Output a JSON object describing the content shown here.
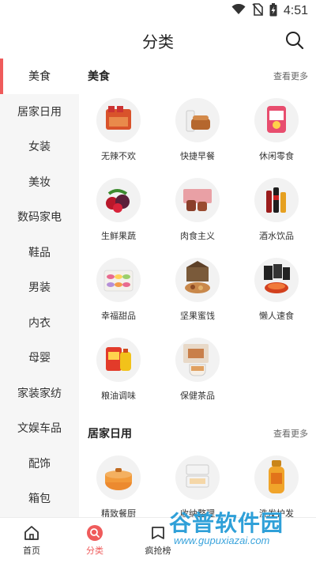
{
  "status": {
    "time": "4:51",
    "icons": [
      "wifi-icon",
      "no-sim-icon",
      "battery-charging-icon"
    ]
  },
  "header": {
    "title": "分类",
    "search_icon": "search-icon"
  },
  "sidebar": {
    "active_index": 0,
    "items": [
      {
        "label": "美食"
      },
      {
        "label": "居家日用"
      },
      {
        "label": "女装"
      },
      {
        "label": "美妆"
      },
      {
        "label": "数码家电"
      },
      {
        "label": "鞋品"
      },
      {
        "label": "男装"
      },
      {
        "label": "内衣"
      },
      {
        "label": "母婴"
      },
      {
        "label": "家装家纺"
      },
      {
        "label": "文娱车品"
      },
      {
        "label": "配饰"
      },
      {
        "label": "箱包"
      }
    ]
  },
  "sections": [
    {
      "title": "美食",
      "more": "查看更多",
      "items": [
        {
          "label": "无辣不欢"
        },
        {
          "label": "快捷早餐"
        },
        {
          "label": "休闲零食"
        },
        {
          "label": "生鲜果蔬"
        },
        {
          "label": "肉食主义"
        },
        {
          "label": "酒水饮品"
        },
        {
          "label": "幸福甜品"
        },
        {
          "label": "坚果蜜饯"
        },
        {
          "label": "懒人速食"
        },
        {
          "label": "粮油调味"
        },
        {
          "label": "保健茶品"
        }
      ]
    },
    {
      "title": "居家日用",
      "more": "查看更多",
      "items": [
        {
          "label": "精致餐厨"
        },
        {
          "label": "收纳整理"
        },
        {
          "label": "洗发护发"
        }
      ]
    }
  ],
  "tabbar": {
    "active_index": 1,
    "items": [
      {
        "label": "首页",
        "icon": "home-icon"
      },
      {
        "label": "分类",
        "icon": "category-search-icon"
      },
      {
        "label": "疯抢榜",
        "icon": "ranking-icon"
      }
    ]
  },
  "watermark": {
    "main": "谷普软件园",
    "sub": "www.gupuxiazai.com"
  },
  "colors": {
    "accent": "#ef5b5b",
    "sidebar_bg": "#f6f6f6",
    "watermark": "#2fa0d8"
  }
}
